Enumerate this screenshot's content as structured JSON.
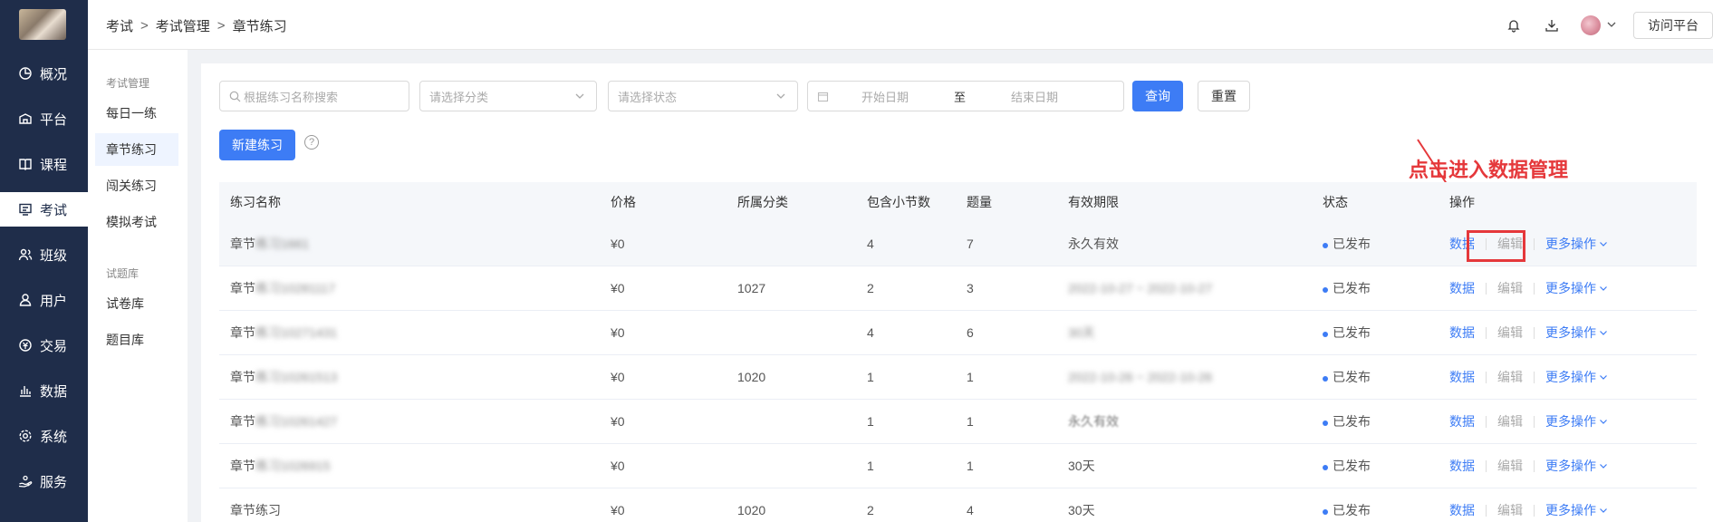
{
  "nav": {
    "items": [
      {
        "label": "概况",
        "icon": "dashboard-icon"
      },
      {
        "label": "平台",
        "icon": "platform-icon"
      },
      {
        "label": "课程",
        "icon": "book-icon"
      },
      {
        "label": "考试",
        "icon": "exam-icon",
        "active": true
      },
      {
        "label": "班级",
        "icon": "class-icon"
      },
      {
        "label": "用户",
        "icon": "user-icon"
      },
      {
        "label": "交易",
        "icon": "transaction-icon"
      },
      {
        "label": "数据",
        "icon": "chart-icon"
      },
      {
        "label": "系统",
        "icon": "gear-icon"
      },
      {
        "label": "服务",
        "icon": "service-icon"
      }
    ]
  },
  "subnav": {
    "group1": "考试管理",
    "items1": [
      "每日一练",
      "章节练习",
      "闯关练习",
      "模拟考试"
    ],
    "group2": "试题库",
    "items2": [
      "试卷库",
      "题目库"
    ]
  },
  "breadcrumb": [
    "考试",
    "考试管理",
    "章节练习"
  ],
  "header": {
    "visit_label": "访问平台"
  },
  "filters": {
    "search_placeholder": "根据练习名称搜索",
    "category_placeholder": "请选择分类",
    "status_placeholder": "请选择状态",
    "start_date": "开始日期",
    "date_sep": "至",
    "end_date": "结束日期",
    "query_label": "查询",
    "reset_label": "重置"
  },
  "new_button": "新建练习",
  "help_glyph": "?",
  "annotation": "点击进入数据管理",
  "table": {
    "headers": [
      "练习名称",
      "价格",
      "所属分类",
      "包含小节数",
      "题量",
      "有效期限",
      "状态",
      "操作"
    ],
    "rows": [
      {
        "name": "章节",
        "name_blur": "练习1661",
        "price": "¥0",
        "category": "",
        "sections": "4",
        "count": "7",
        "validity": "永久有效",
        "validity_blur": false,
        "status": "已发布"
      },
      {
        "name": "章节",
        "name_blur": "练习10281117",
        "price": "¥0",
        "category": "1027",
        "sections": "2",
        "count": "3",
        "validity": "2022-10-27 ~ 2022-10-27",
        "validity_blur": true,
        "status": "已发布"
      },
      {
        "name": "章节",
        "name_blur": "练习10271431",
        "price": "¥0",
        "category": "",
        "sections": "4",
        "count": "6",
        "validity": "30天",
        "validity_blur": true,
        "status": "已发布"
      },
      {
        "name": "章节",
        "name_blur": "练习10261513",
        "price": "¥0",
        "category": "1020",
        "sections": "1",
        "count": "1",
        "validity": "2022-10-26 ~ 2022-10-26",
        "validity_blur": true,
        "status": "已发布"
      },
      {
        "name": "章节",
        "name_blur": "练习10261427",
        "price": "¥0",
        "category": "",
        "sections": "1",
        "count": "1",
        "validity": "永久有效",
        "validity_blur": "partial",
        "status": "已发布"
      },
      {
        "name": "章节",
        "name_blur": "练习1026915",
        "price": "¥0",
        "category": "",
        "sections": "1",
        "count": "1",
        "validity": "30天",
        "validity_blur": false,
        "status": "已发布"
      },
      {
        "name": "章节练习",
        "name_blur": "",
        "price": "¥0",
        "category": "1020",
        "sections": "2",
        "count": "4",
        "validity": "30天",
        "validity_blur": false,
        "status": "已发布"
      }
    ],
    "ops": {
      "data": "数据",
      "edit": "编辑",
      "more": "更多操作"
    }
  },
  "colors": {
    "nav_bg": "#1f2d4a",
    "primary": "#3d7cf5",
    "annotation": "#e5383b"
  }
}
